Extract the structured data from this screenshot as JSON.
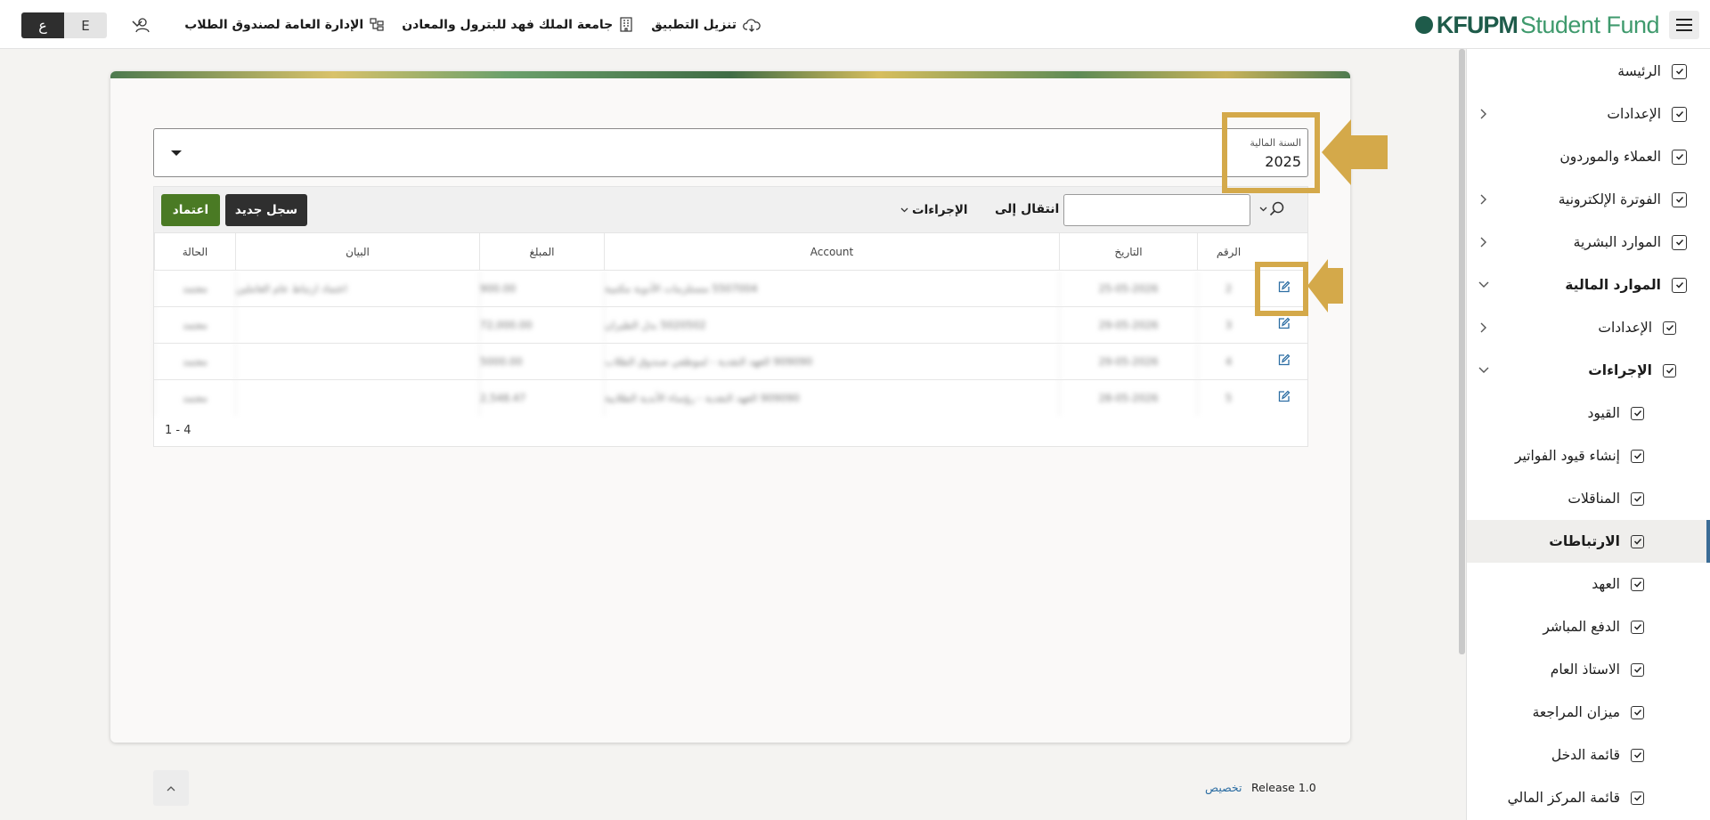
{
  "header": {
    "logo_kfupm": "KFUPM",
    "logo_student_fund": "Student Fund",
    "links": [
      {
        "label": "تنزيل التطبيق",
        "icon": "cloud-download-icon"
      },
      {
        "label": "جامعة الملك فهد للبترول والمعادن",
        "icon": "building-icon"
      },
      {
        "label": "الإدارة العامة لصندوق الطلاب",
        "icon": "org-chart-icon"
      }
    ],
    "user_icon": "user-icon",
    "lang_ar": "ع",
    "lang_en": "E"
  },
  "sidebar": {
    "items": [
      {
        "label": "الرئيسة",
        "level": 0,
        "expandable": false
      },
      {
        "label": "الإعدادات",
        "level": 0,
        "expandable": true
      },
      {
        "label": "العملاء والموردون",
        "level": 0,
        "expandable": false
      },
      {
        "label": "الفوترة الإلكترونية",
        "level": 0,
        "expandable": true
      },
      {
        "label": "الموارد البشرية",
        "level": 0,
        "expandable": true
      },
      {
        "label": "الموارد المالية",
        "level": 0,
        "expandable": true,
        "expanded": true,
        "bold": true
      },
      {
        "label": "الإعدادات",
        "level": 1,
        "expandable": true
      },
      {
        "label": "الإجراءات",
        "level": 1,
        "expandable": true,
        "expanded": true,
        "bold": true
      },
      {
        "label": "القيود",
        "level": 2
      },
      {
        "label": "إنشاء قيود الفواتير",
        "level": 2
      },
      {
        "label": "المناقلات",
        "level": 2
      },
      {
        "label": "الارتباطات",
        "level": 2,
        "active": true,
        "bold": true
      },
      {
        "label": "العهد",
        "level": 2
      },
      {
        "label": "الدفع المباشر",
        "level": 2
      },
      {
        "label": "الاستاذ العام",
        "level": 2
      },
      {
        "label": "ميزان المراجعة",
        "level": 2
      },
      {
        "label": "قائمة الدخل",
        "level": 2
      },
      {
        "label": "قائمة المركز المالي",
        "level": 2
      }
    ]
  },
  "fiscal_year": {
    "label": "السنة المالية",
    "value": "2025"
  },
  "toolbar": {
    "search_placeholder": "",
    "goto_label": "انتقال إلى",
    "actions_label": "الإجراءات",
    "new_record_label": "سجل جديد",
    "approve_label": "اعتماد"
  },
  "table": {
    "columns": [
      "الرقم",
      "التاريخ",
      "Account",
      "المبلغ",
      "البيان",
      "الحالة"
    ],
    "rows": [
      {
        "number": "2",
        "date": "25-05-2026",
        "account": "5507004 مستلزمات الأدوية مكتبية",
        "amount": "900.00",
        "description": "اعتماد ارتباط عام العاملين",
        "status": "معتمد"
      },
      {
        "number": "3",
        "date": "29-05-2026",
        "account": "5020502 بدل الطيران",
        "amount": "72,000.00",
        "description": "",
        "status": "معتمد"
      },
      {
        "number": "4",
        "date": "29-05-2026",
        "account": "909090 العهد النقدية - لموظفي صندوق الطلاب",
        "amount": "5000.00",
        "description": "",
        "status": "معتمد"
      },
      {
        "number": "5",
        "date": "28-05-2026",
        "account": "909090 العهد النقدية - رؤساء الأندية الطلابية",
        "amount": "2,548.47",
        "description": "",
        "status": "معتمد"
      }
    ],
    "pagination": "1 - 4"
  },
  "footer": {
    "release": "Release 1.0",
    "customize": "تخصيص"
  },
  "colors": {
    "brand_dark": "#1e5b4a",
    "brand_light": "#3f9a6d",
    "approve": "#4a7a24",
    "annotation": "#d4a94a",
    "active_indicator": "#3b6c96"
  }
}
